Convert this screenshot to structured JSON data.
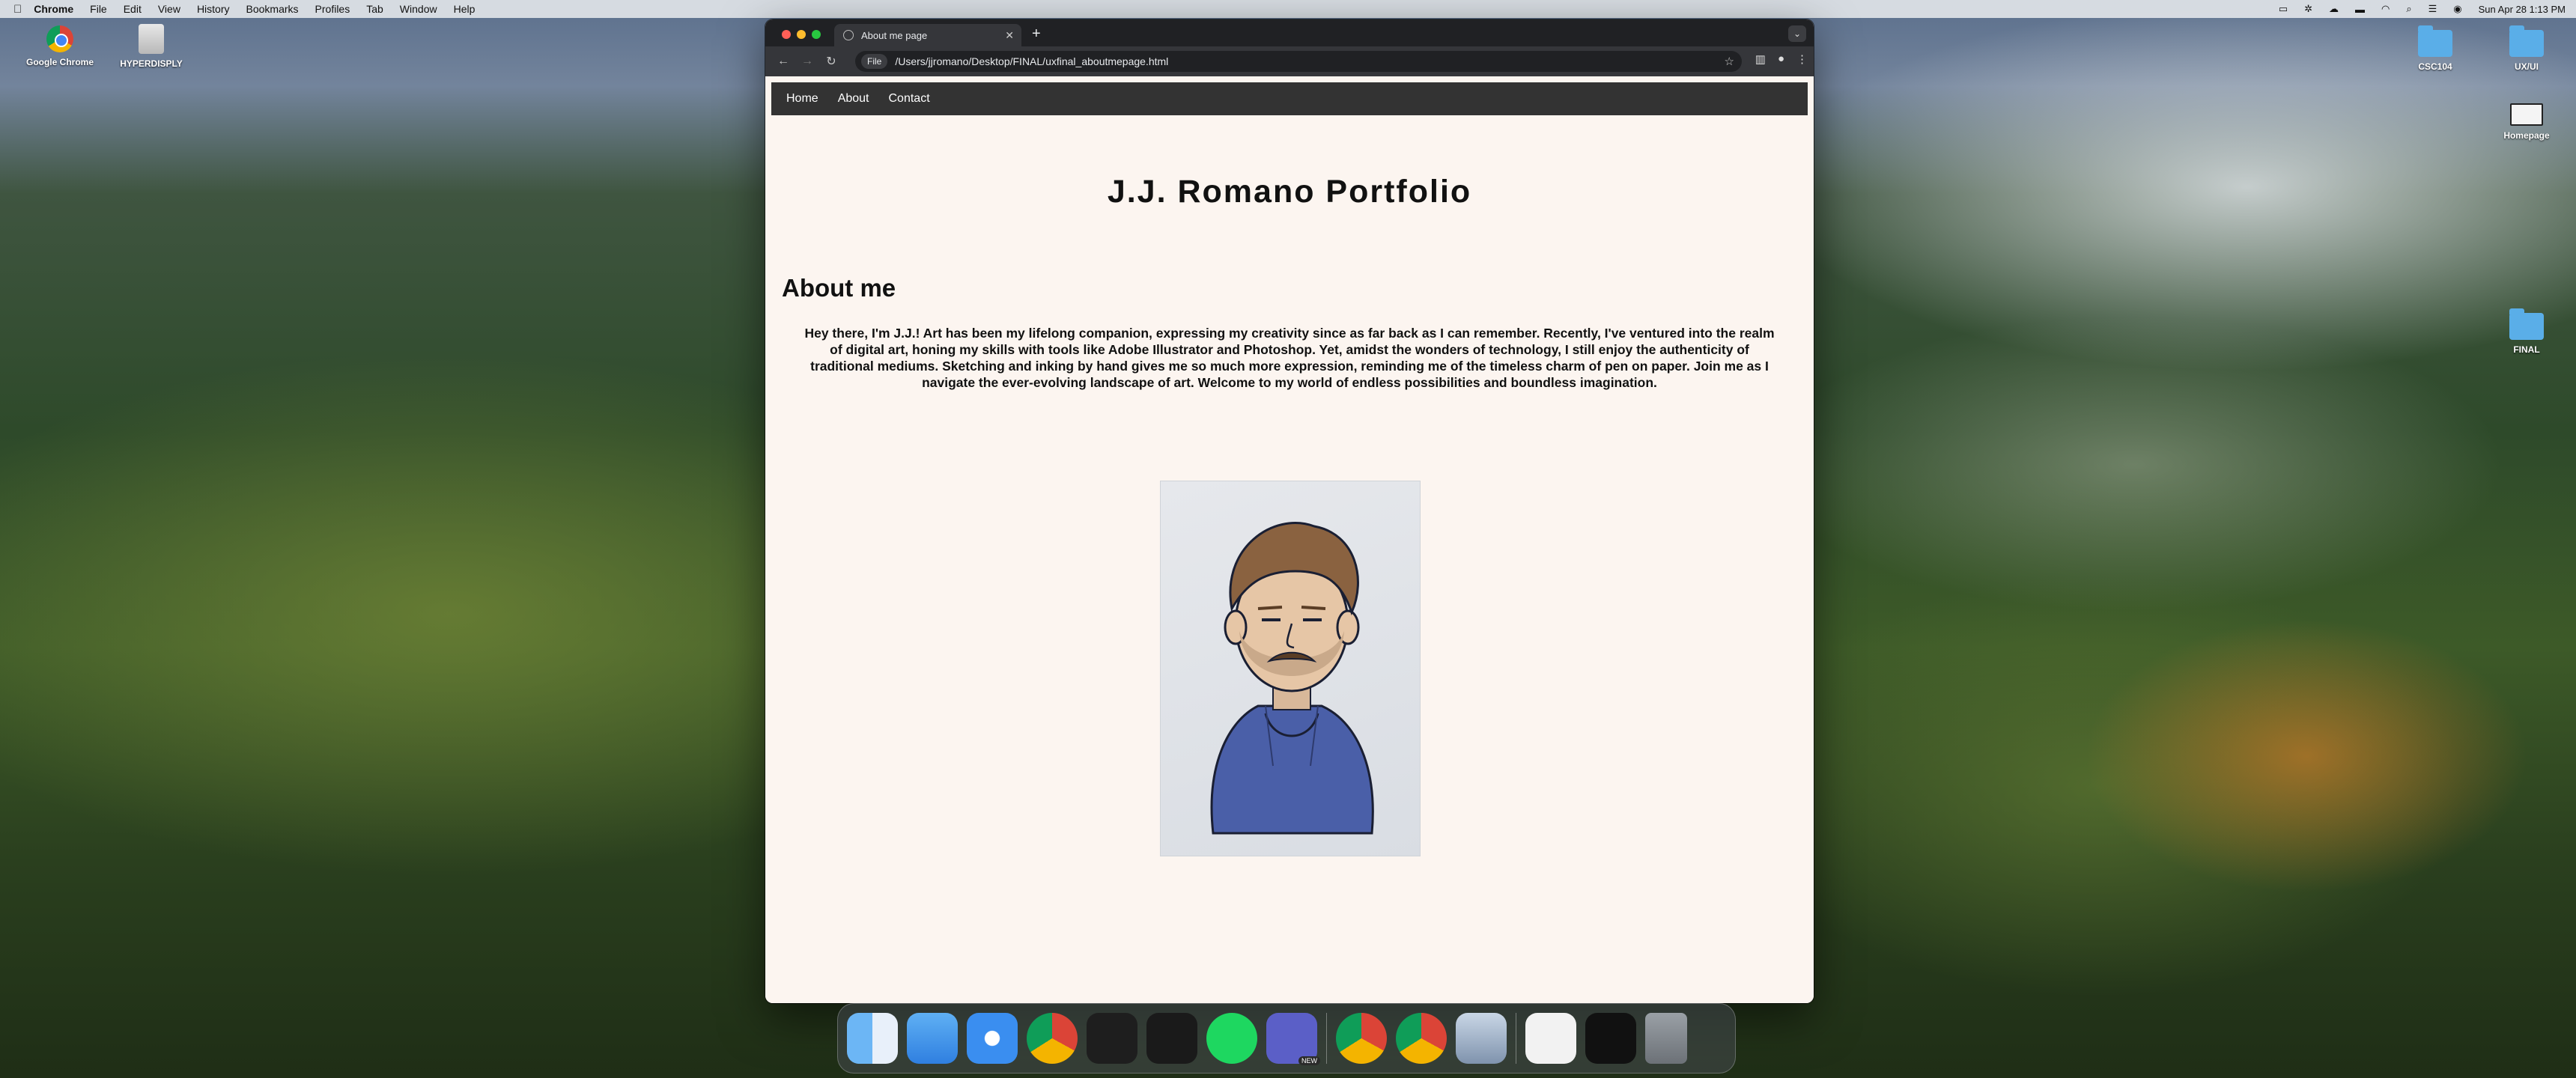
{
  "menubar": {
    "apple": "",
    "items": [
      "Chrome",
      "File",
      "Edit",
      "View",
      "History",
      "Bookmarks",
      "Profiles",
      "Tab",
      "Window",
      "Help"
    ],
    "datetime": "Sun Apr 28  1:13 PM"
  },
  "desktop_icons": [
    {
      "label": "Google Chrome"
    },
    {
      "label": "HYPERDISPLY"
    },
    {
      "label": "CSC104"
    },
    {
      "label": "UX/UI"
    },
    {
      "label": "Homepage"
    },
    {
      "label": "FINAL"
    }
  ],
  "browser": {
    "tab_title": "About me page",
    "new_tab": "+",
    "scheme_chip": "File",
    "url": "/Users/jjromano/Desktop/FINAL/uxfinal_aboutmepage.html"
  },
  "site": {
    "nav": [
      "Home",
      "About",
      "Contact"
    ],
    "title": "J.J. Romano Portfolio",
    "about_heading": "About me",
    "about_text": "Hey there, I'm J.J.! Art has been my lifelong companion, expressing my creativity since as far back as I can remember. Recently, I've ventured into the realm of digital art, honing my skills with tools like Adobe Illustrator and Photoshop. Yet, amidst the wonders of technology, I still enjoy the authenticity of traditional mediums. Sketching and inking by hand gives me so much more expression, reminding me of the timeless charm of pen on paper. Join me as I navigate the ever-evolving landscape of art. Welcome to my world of endless possibilities and boundless imagination."
  },
  "dock": {
    "items": [
      "finder",
      "mail",
      "safari",
      "chrome",
      "vscode",
      "figma",
      "spotify",
      "teams",
      "chrome",
      "chrome",
      "preview",
      "document-thumbnail",
      "terminal-thumbnail",
      "trash"
    ],
    "teams_badge": "NEW"
  },
  "colors": {
    "page_bg": "#fcf5f0",
    "nav_bg": "#333333",
    "browser_frame": "#35363a",
    "hoodie": "#4a5fa8",
    "hair": "#8a6240"
  }
}
